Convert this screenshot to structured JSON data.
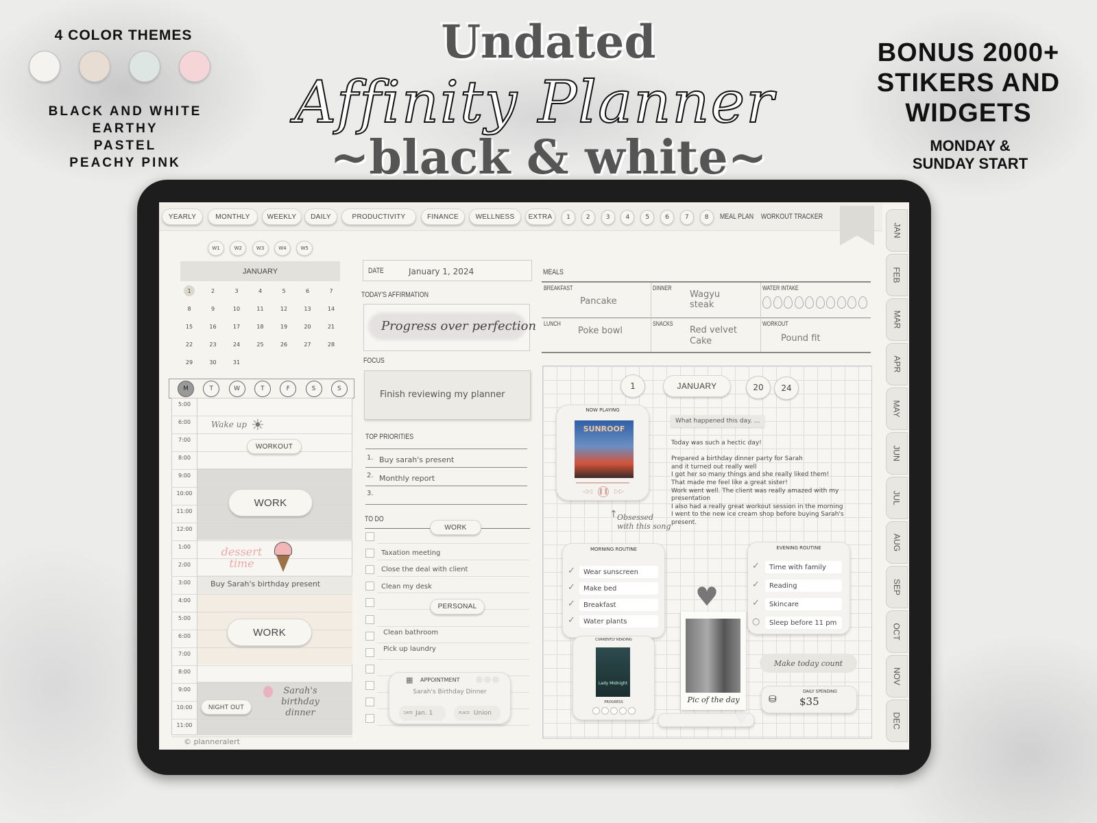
{
  "promo": {
    "themes_title": "4 COLOR THEMES",
    "theme_colors": [
      "#f4f3ef",
      "#e8ddd3",
      "#dde6e3",
      "#f6d5d8"
    ],
    "theme_names": [
      "BLACK AND WHITE",
      "EARTHY",
      "PASTEL",
      "PEACHY PINK"
    ],
    "title_line1": "Undated",
    "title_line2": "Affinity Planner",
    "title_line3": "~black & white~",
    "bonus": "BONUS 2000+ STIKERS AND WIDGETS",
    "start": "MONDAY & SUNDAY START"
  },
  "nav": {
    "tabs": [
      "YEARLY",
      "MONTHLY",
      "WEEKLY",
      "DAILY",
      "PRODUCTIVITY",
      "FINANCE",
      "WELLNESS",
      "EXTRA"
    ],
    "numbers": [
      "1",
      "2",
      "3",
      "4",
      "5",
      "6",
      "7",
      "8"
    ],
    "links": [
      "MEAL PLAN",
      "WORKOUT TRACKER"
    ],
    "weeks": [
      "W1",
      "W2",
      "W3",
      "W4",
      "W5"
    ],
    "months": [
      "JAN",
      "FEB",
      "MAR",
      "APR",
      "MAY",
      "JUN",
      "JUL",
      "AUG",
      "SEP",
      "OCT",
      "NOV",
      "DEC"
    ]
  },
  "calendar": {
    "month": "JANUARY",
    "days": [
      "1",
      "2",
      "3",
      "4",
      "5",
      "6",
      "7",
      "8",
      "9",
      "10",
      "11",
      "12",
      "13",
      "14",
      "15",
      "16",
      "17",
      "18",
      "19",
      "20",
      "21",
      "22",
      "23",
      "24",
      "25",
      "26",
      "27",
      "28",
      "29",
      "30",
      "31"
    ],
    "selected_day": "1",
    "weekdays": [
      "M",
      "T",
      "W",
      "T",
      "F",
      "S",
      "S"
    ],
    "selected_weekday": "M"
  },
  "schedule": {
    "times": [
      "5:00",
      "6:00",
      "7:00",
      "8:00",
      "9:00",
      "10:00",
      "11:00",
      "12:00",
      "1:00",
      "2:00",
      "3:00",
      "4:00",
      "5:00",
      "6:00",
      "7:00",
      "8:00",
      "9:00",
      "10:00",
      "11:00"
    ],
    "wake_up": "Wake up",
    "workout": "WORKOUT",
    "work_1": "WORK",
    "dessert_sticker": "dessert time",
    "present": "Buy Sarah's birthday present",
    "work_2": "WORK",
    "night_out": "NIGHT OUT",
    "dinner_sticker": "Sarah's birthday dinner",
    "copyright": "© planneralert"
  },
  "center": {
    "date_label": "DATE",
    "date_value": "January 1, 2024",
    "affirmation_label": "TODAY'S AFFIRMATION",
    "affirmation": "Progress over perfection",
    "focus_label": "FOCUS",
    "focus": "Finish reviewing my planner",
    "priorities_label": "TOP PRIORITIES",
    "priorities": [
      {
        "num": "1.",
        "text": "Buy sarah's present"
      },
      {
        "num": "2.",
        "text": "Monthly report"
      },
      {
        "num": "3.",
        "text": ""
      }
    ],
    "todo_label": "TO DO",
    "todo_work_header": "WORK",
    "todo_work": [
      "",
      "Taxation meeting",
      "Close the deal with client",
      "Clean my desk"
    ],
    "todo_personal_header": "PERSONAL",
    "todo_personal": [
      "",
      "Clean bathroom",
      "Pick up laundry"
    ],
    "appointment": {
      "title": "APPOINTMENT",
      "event": "Sarah's Birthday Dinner",
      "date_label": "DATE",
      "date": "Jan. 1",
      "place_label": "PLACE",
      "place": "Union"
    }
  },
  "meals": {
    "label": "MEALS",
    "breakfast_label": "BREAKFAST",
    "breakfast": "Pancake",
    "dinner_label": "DINNER",
    "dinner": "Wagyu steak",
    "water_label": "WATER INTAKE",
    "water_total": 10,
    "water_filled": 0,
    "lunch_label": "LUNCH",
    "lunch": "Poke bowl",
    "snacks_label": "SNACKS",
    "snacks": "Red velvet Cake",
    "workout_label": "WORKOUT",
    "workout": "Pound fit"
  },
  "journal": {
    "day": "1",
    "month": "JANUARY",
    "year_a": "20",
    "year_b": "24",
    "now_playing": "NOW PLAYING",
    "album_title": "SUNROOF",
    "song_note": "Obsessed with this song",
    "prompt": "What happened this day. ...",
    "entry": [
      "Today was such a hectic day!",
      "",
      "Prepared a birthday dinner party for Sarah",
      "and it turned out really well",
      "I got her so many things and she really liked them!",
      "That made me feel like a great sister!",
      "Work went well. The client was really amazed with my",
      "presentation",
      "I also had a really great workout session in the morning",
      "I went to the new ice cream shop before buying Sarah's",
      "present."
    ]
  },
  "morning_routine": {
    "title": "MORNING ROUTINE",
    "items": [
      "Wear sunscreen",
      "Make bed",
      "Breakfast",
      "Water plants"
    ]
  },
  "evening_routine": {
    "title": "EVENING ROUTINE",
    "items": [
      "Time with family",
      "Reading",
      "Skincare",
      "Sleep before 11 pm"
    ],
    "checked": [
      true,
      true,
      true,
      false
    ]
  },
  "reading": {
    "title": "CURRENTLY READING",
    "book": "Lady Midnight",
    "progress_label": "PROGRESS",
    "progress_dots": 5
  },
  "photo": {
    "caption": "Pic of the day"
  },
  "motivation": "Make today count",
  "spending": {
    "label": "DAILY SPENDING",
    "amount": "$35"
  }
}
